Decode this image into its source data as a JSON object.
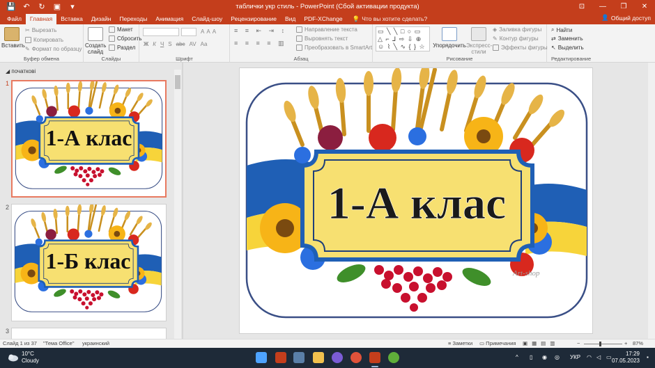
{
  "window": {
    "title": "таблички укр стиль - PowerPoint (Сбой активации продукта)",
    "minimize": "—",
    "restore": "❐",
    "close": "✕",
    "ribbon_opts": "⊡"
  },
  "qat": {
    "save": "💾",
    "undo": "↶",
    "redo": "↻",
    "present": "▣",
    "more": "▾"
  },
  "tabs": [
    {
      "label": "Файл"
    },
    {
      "label": "Главная"
    },
    {
      "label": "Вставка"
    },
    {
      "label": "Дизайн"
    },
    {
      "label": "Переходы"
    },
    {
      "label": "Анимация"
    },
    {
      "label": "Слайд-шоу"
    },
    {
      "label": "Рецензирование"
    },
    {
      "label": "Вид"
    },
    {
      "label": "PDF-XChange"
    }
  ],
  "tell_me": {
    "icon": "💡",
    "label": "Что вы хотите сделать?"
  },
  "share": {
    "icon": "👤",
    "label": "Общий доступ"
  },
  "ribbon": {
    "clipboard": {
      "paste": "Вставить",
      "cut": "Вырезать",
      "copy": "Копировать",
      "format_painter": "Формат по образцу",
      "label": "Буфер обмена"
    },
    "slides": {
      "new_slide": "Создать слайд",
      "layout": "Макет",
      "reset": "Сбросить",
      "section": "Раздел",
      "label": "Слайды"
    },
    "font": {
      "label": "Шрифт",
      "bold": "Ж",
      "italic": "К",
      "underline": "Ч",
      "shadow": "S",
      "strike": "abc",
      "spacing": "AV",
      "case": "Aa",
      "grow": "A",
      "shrink": "A",
      "clear": "A"
    },
    "paragraph": {
      "text_dir": "Направление текста",
      "align_text": "Выровнять текст",
      "smartart": "Преобразовать в SmartArt",
      "label": "Абзац"
    },
    "drawing": {
      "arrange": "Упорядочить",
      "quick_styles": "Экспресс-стили",
      "fill": "Заливка фигуры",
      "outline": "Контур фигуры",
      "effects": "Эффекты фигуры",
      "label": "Рисование",
      "shapes_glyphs": "▭ ╲ ╲ □ ○ ▭ △ ⌐ ⅃ ⇨ ⇩ ⊕ ☺ ⌇ ╲ ∿ { } ☆ ▾"
    },
    "editing": {
      "find": "Найти",
      "replace": "Заменить",
      "select": "Выделить",
      "label": "Редактирование"
    }
  },
  "panel": {
    "section_name": "початкові",
    "slides": [
      {
        "num": "1",
        "text": "1-А клас"
      },
      {
        "num": "2",
        "text": "1-Б клас"
      },
      {
        "num": "3",
        "text": ""
      }
    ]
  },
  "main_slide": {
    "text": "1-А клас",
    "watermark": "Art-shop"
  },
  "status": {
    "slide_info": "Слайд 1 из 37",
    "theme": "\"Тема Office\"",
    "language": "украинский",
    "notes": "Заметки",
    "comments": "Примечания",
    "zoom": "87%",
    "minus": "−",
    "plus": "+"
  },
  "taskbar": {
    "temp": "10°C",
    "weather": "Cloudy",
    "lang": "УКР",
    "time": "17:29",
    "date": "07.05.2023",
    "chevron": "^"
  },
  "colors": {
    "accent": "#c43e1c",
    "ukraine_blue": "#1f5fb5",
    "ukraine_yellow": "#f7d43a",
    "frame_navy": "#3a4f86"
  }
}
